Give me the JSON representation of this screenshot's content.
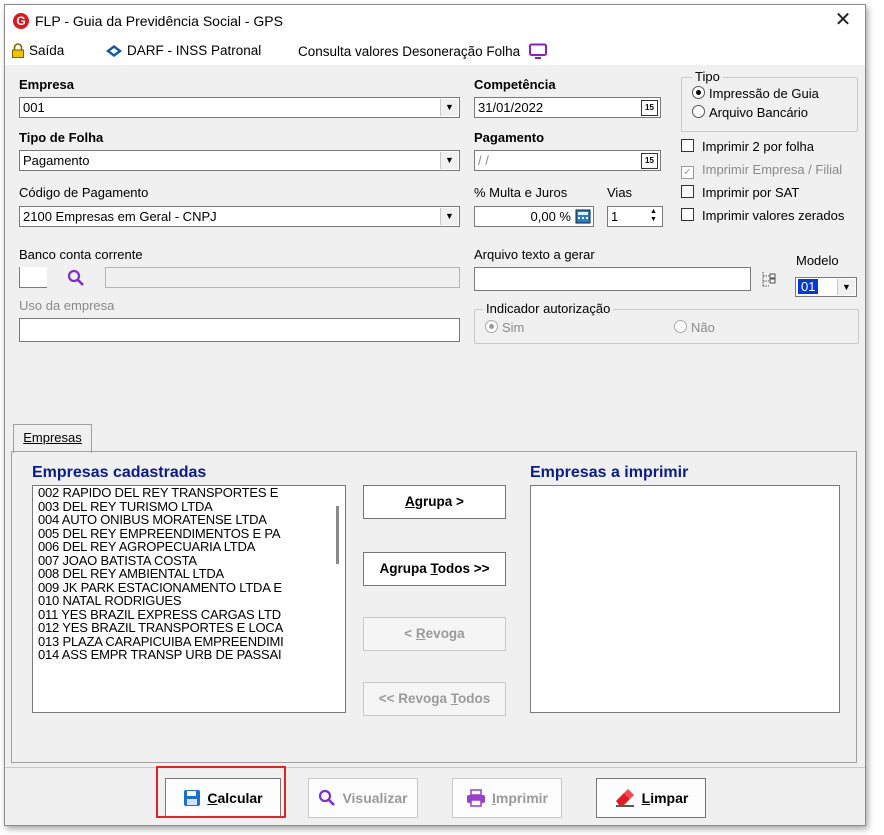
{
  "window": {
    "title": "FLP - Guia da Previdência Social - GPS",
    "logo_letter": "G",
    "close_glyph": "✕"
  },
  "toolbar": {
    "saida": "Saída",
    "darf": "DARF - INSS Patronal",
    "consulta": "Consulta valores Desoneração Folha"
  },
  "form": {
    "empresa": {
      "label": "Empresa",
      "value": "001"
    },
    "tipo_folha": {
      "label": "Tipo de Folha",
      "value": "Pagamento"
    },
    "codigo_pagamento": {
      "label": "Código de Pagamento",
      "value": "2100  Empresas em Geral - CNPJ"
    },
    "banco": {
      "label": "Banco conta corrente",
      "code": "",
      "name": ""
    },
    "uso_empresa": {
      "label": "Uso da empresa",
      "value": ""
    },
    "competencia": {
      "label": "Competência",
      "value": "31/01/2022",
      "cal": "15"
    },
    "pagamento": {
      "label": "Pagamento",
      "value": " / /",
      "cal": "15"
    },
    "multa": {
      "label": "% Multa e Juros",
      "value": "0,00 %"
    },
    "vias": {
      "label": "Vias",
      "value": "1"
    },
    "arquivo": {
      "label": "Arquivo texto a gerar",
      "value": ""
    },
    "modelo": {
      "label": "Modelo",
      "value": "01"
    },
    "indicador": {
      "title": "Indicador autorização",
      "sim": "Sim",
      "nao": "Não"
    },
    "tipo": {
      "title": "Tipo",
      "opt1": "Impressão de Guia",
      "opt2": "Arquivo Bancário"
    },
    "checks": {
      "c1": "Imprimir 2 por folha",
      "c2": "Imprimir Empresa / Filial",
      "c3": "Imprimir por SAT",
      "c4": "Imprimir valores zerados"
    }
  },
  "tabs": {
    "empresas": "Empresas"
  },
  "lists": {
    "cadastradas_title": "Empresas cadastradas",
    "imprimir_title": "Empresas a imprimir",
    "cadastradas": [
      "002 RAPIDO DEL REY TRANSPORTES E",
      "003 DEL REY TURISMO LTDA",
      "004 AUTO ONIBUS MORATENSE LTDA",
      "005 DEL REY EMPREENDIMENTOS E PA",
      "006 DEL REY AGROPECUARIA LTDA",
      "007 JOAO BATISTA COSTA",
      "008 DEL REY AMBIENTAL LTDA",
      "009 JK PARK ESTACIONAMENTO LTDA E",
      "010 NATAL RODRIGUES",
      "011 YES BRAZIL EXPRESS CARGAS LTD",
      "012 YES BRAZIL TRANSPORTES E LOCA",
      "013 PLAZA CARAPICUIBA EMPREENDIMI",
      "014 ASS EMPR TRANSP URB DE PASSAI"
    ]
  },
  "buttons": {
    "agrupa_pre": "",
    "agrupa_u": "A",
    "agrupa_post": "grupa >",
    "agrupa_todos_pre": "Agrupa ",
    "agrupa_todos_u": "T",
    "agrupa_todos_post": "odos >>",
    "revoga_pre": "< ",
    "revoga_u": "R",
    "revoga_post": "evoga",
    "revoga_todos_pre": "<< Revoga ",
    "revoga_todos_u": "T",
    "revoga_todos_post": "odos"
  },
  "footer": {
    "calcular_u": "C",
    "calcular_post": "alcular",
    "visualizar": "Visualizar",
    "imprimir_u": "I",
    "imprimir_post": "mprimir",
    "limpar_u": "L",
    "limpar_post": "impar"
  }
}
